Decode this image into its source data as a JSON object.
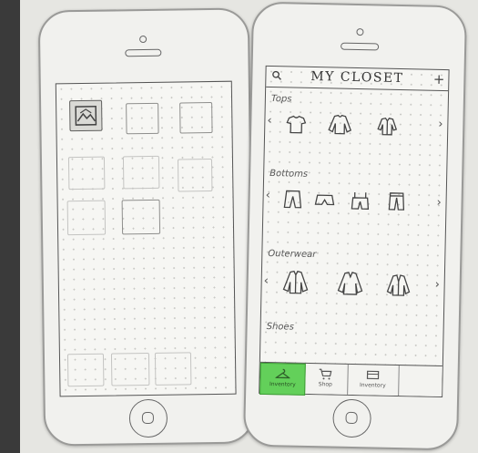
{
  "right_app": {
    "title": "MY CLOSET",
    "header_icons": {
      "search": "search-icon",
      "add": "+"
    },
    "categories": [
      {
        "label": "Tops"
      },
      {
        "label": "Bottoms"
      },
      {
        "label": "Outerwear"
      },
      {
        "label": "Shoes"
      }
    ],
    "tabs": [
      {
        "label": "Inventory",
        "icon": "hanger-icon",
        "active": true
      },
      {
        "label": "Shop",
        "icon": "cart-icon",
        "active": false
      },
      {
        "label": "Inventory",
        "icon": "card-icon",
        "active": false
      },
      {
        "label": "",
        "icon": "",
        "active": false
      }
    ],
    "colors": {
      "active_tab": "#63d05a"
    }
  },
  "left_app": {
    "first_tile_icon": "image-icon"
  }
}
